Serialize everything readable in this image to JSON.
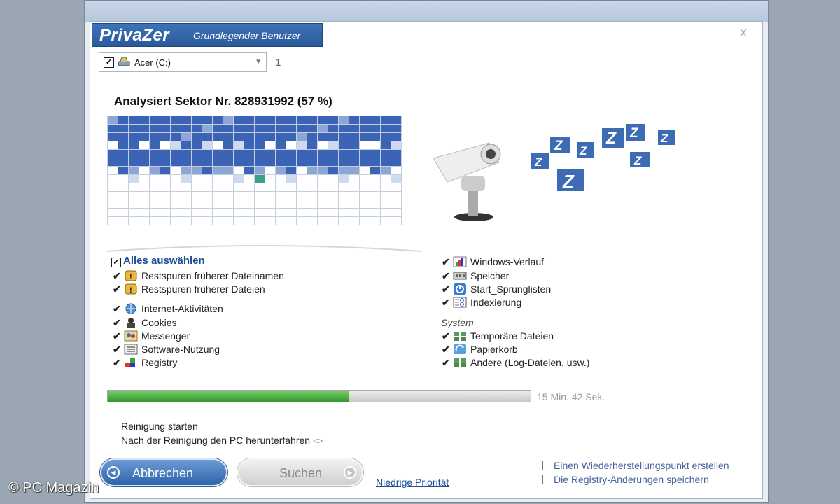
{
  "app": {
    "logo": "PrivaZer",
    "subtitle": "Grundlegender Benutzer",
    "minimize": "_",
    "close": "X"
  },
  "drive": {
    "checked": "✓",
    "label": "Acer (C:)",
    "count": "1"
  },
  "scan": {
    "title": "Analysiert Sektor Nr. 828931992 (57 %)"
  },
  "options": {
    "select_all": "Alles auswählen",
    "left": [
      {
        "label": "Restspuren früherer Dateinamen",
        "icon": "shield-warning-icon"
      },
      {
        "label": "Restspuren früherer Dateien",
        "icon": "shield-warning-icon"
      },
      {
        "label": "Internet-Aktivitäten",
        "icon": "globe-icon"
      },
      {
        "label": "Cookies",
        "icon": "person-icon"
      },
      {
        "label": "Messenger",
        "icon": "messenger-icon"
      },
      {
        "label": "Software-Nutzung",
        "icon": "list-icon"
      },
      {
        "label": "Registry",
        "icon": "registry-icon"
      }
    ],
    "right": [
      {
        "label": "Windows-Verlauf",
        "icon": "chart-icon"
      },
      {
        "label": "Speicher",
        "icon": "memory-icon"
      },
      {
        "label": "Start_Sprunglisten",
        "icon": "power-icon"
      },
      {
        "label": "Indexierung",
        "icon": "index-icon"
      }
    ],
    "system_label": "System",
    "system": [
      {
        "label": "Temporäre Dateien",
        "icon": "folders-icon"
      },
      {
        "label": "Papierkorb",
        "icon": "recycle-icon"
      },
      {
        "label": "Andere (Log-Dateien, usw.)",
        "icon": "folders-icon"
      }
    ]
  },
  "progress": {
    "fraction": 0.57,
    "remaining": "15 Min.  42 Sek."
  },
  "post": {
    "start": "Reinigung starten",
    "shutdown": "Nach der Reinigung den PC herunterfahren",
    "shutdown_arrows": "<>"
  },
  "buttons": {
    "abort": "Abbrechen",
    "search": "Suchen",
    "low_priority": "Niedrige Priorität"
  },
  "extras": {
    "restore_point": "Einen Wiederherstellungspunkt erstellen",
    "save_registry": "Die Registry-Änderungen speichern"
  },
  "watermark": "© PC Magazin",
  "colors": {
    "brand": "#2b5a9a",
    "progress": "#2e9a2e",
    "link": "#1f4e9a"
  }
}
